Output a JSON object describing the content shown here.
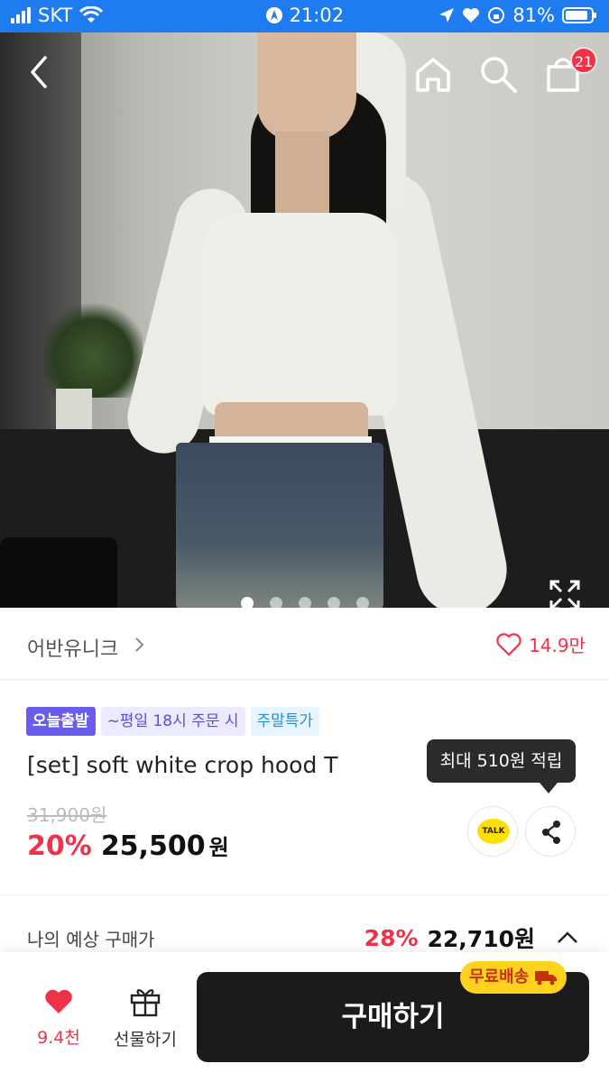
{
  "status_bar": {
    "carrier": "SKT",
    "time": "21:02",
    "battery": "81%"
  },
  "header": {
    "cart_count": "21"
  },
  "gallery": {
    "image_count": 5,
    "active_index": 0
  },
  "brand": {
    "name": "어반유니크",
    "likes": "14.9만"
  },
  "badges": {
    "today": "오늘출발",
    "cutoff": "~평일 18시 주문 시",
    "weekend": "주말특가"
  },
  "tooltip": "최대 510원 적립",
  "product": {
    "title": "[set] soft white crop hood T",
    "original_price": "31,900원",
    "discount": "20%",
    "price": "25,500",
    "price_unit": "원"
  },
  "estimate": {
    "label": "나의 예상 구매가",
    "discount": "28%",
    "price": "22,710원"
  },
  "bottom": {
    "wish_count": "9.4천",
    "gift_label": "선물하기",
    "buy_label": "구매하기",
    "free_shipping": "무료배송"
  },
  "talk_label": "TALK",
  "colors": {
    "accent": "#f0314a",
    "status_bar": "#1e7bf0",
    "buy_button": "#1b1b1b",
    "free_ship": "#ffd21e"
  }
}
